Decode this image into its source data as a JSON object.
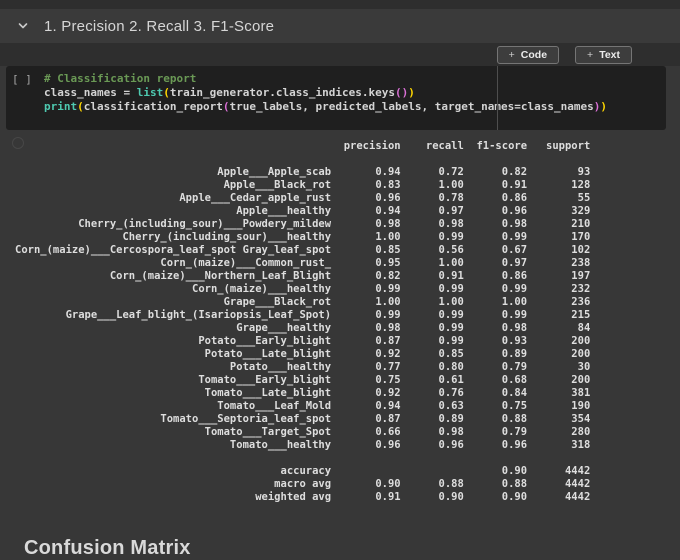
{
  "header": {
    "title": "1. Precision 2. Recall 3. F1-Score"
  },
  "toolbar": {
    "plus": "+",
    "code_label": "Code",
    "text_label": "Text"
  },
  "code": {
    "indicator": "[ ]",
    "token_colors": {
      "comment": "#6a9955",
      "plain": "#d4d4d4",
      "func": "#4ec9b0",
      "bracket1": "#ffd700",
      "bracket2": "#da70d6"
    },
    "lines": [
      [
        [
          "# Classification report",
          "comment"
        ]
      ],
      [
        [
          "class_names ",
          "plain"
        ],
        [
          "= ",
          "plain"
        ],
        [
          "list",
          "func"
        ],
        [
          "(",
          "bracket1"
        ],
        [
          "train_generator.class_indices.keys",
          "plain"
        ],
        [
          "(",
          "bracket2"
        ],
        [
          ")",
          "bracket2"
        ],
        [
          ")",
          "bracket1"
        ]
      ],
      [
        [
          "print",
          "func"
        ],
        [
          "(",
          "bracket1"
        ],
        [
          "classification_report",
          "plain"
        ],
        [
          "(",
          "bracket2"
        ],
        [
          "true_labels, predicted_labels, target_names",
          "plain"
        ],
        [
          "=",
          "plain"
        ],
        [
          "class_names",
          "plain"
        ],
        [
          ")",
          "bracket2"
        ],
        [
          ")",
          "bracket1"
        ]
      ]
    ]
  },
  "report": {
    "columns": [
      "precision",
      "recall",
      "f1-score",
      "support"
    ],
    "rows": [
      [
        "Apple___Apple_scab",
        "0.94",
        "0.72",
        "0.82",
        "93"
      ],
      [
        "Apple___Black_rot",
        "0.83",
        "1.00",
        "0.91",
        "128"
      ],
      [
        "Apple___Cedar_apple_rust",
        "0.96",
        "0.78",
        "0.86",
        "55"
      ],
      [
        "Apple___healthy",
        "0.94",
        "0.97",
        "0.96",
        "329"
      ],
      [
        "Cherry_(including_sour)___Powdery_mildew",
        "0.98",
        "0.98",
        "0.98",
        "210"
      ],
      [
        "Cherry_(including_sour)___healthy",
        "1.00",
        "0.99",
        "0.99",
        "170"
      ],
      [
        "Corn_(maize)___Cercospora_leaf_spot Gray_leaf_spot",
        "0.85",
        "0.56",
        "0.67",
        "102"
      ],
      [
        "Corn_(maize)___Common_rust_",
        "0.95",
        "1.00",
        "0.97",
        "238"
      ],
      [
        "Corn_(maize)___Northern_Leaf_Blight",
        "0.82",
        "0.91",
        "0.86",
        "197"
      ],
      [
        "Corn_(maize)___healthy",
        "0.99",
        "0.99",
        "0.99",
        "232"
      ],
      [
        "Grape___Black_rot",
        "1.00",
        "1.00",
        "1.00",
        "236"
      ],
      [
        "Grape___Leaf_blight_(Isariopsis_Leaf_Spot)",
        "0.99",
        "0.99",
        "0.99",
        "215"
      ],
      [
        "Grape___healthy",
        "0.98",
        "0.99",
        "0.98",
        "84"
      ],
      [
        "Potato___Early_blight",
        "0.87",
        "0.99",
        "0.93",
        "200"
      ],
      [
        "Potato___Late_blight",
        "0.92",
        "0.85",
        "0.89",
        "200"
      ],
      [
        "Potato___healthy",
        "0.77",
        "0.80",
        "0.79",
        "30"
      ],
      [
        "Tomato___Early_blight",
        "0.75",
        "0.61",
        "0.68",
        "200"
      ],
      [
        "Tomato___Late_blight",
        "0.92",
        "0.76",
        "0.84",
        "381"
      ],
      [
        "Tomato___Leaf_Mold",
        "0.94",
        "0.63",
        "0.75",
        "190"
      ],
      [
        "Tomato___Septoria_leaf_spot",
        "0.87",
        "0.89",
        "0.88",
        "354"
      ],
      [
        "Tomato___Target_Spot",
        "0.66",
        "0.98",
        "0.79",
        "280"
      ],
      [
        "Tomato___healthy",
        "0.96",
        "0.96",
        "0.96",
        "318"
      ]
    ],
    "summary": [
      [
        "accuracy",
        "",
        "",
        "0.90",
        "4442"
      ],
      [
        "macro avg",
        "0.90",
        "0.88",
        "0.88",
        "4442"
      ],
      [
        "weighted avg",
        "0.91",
        "0.90",
        "0.90",
        "4442"
      ]
    ]
  },
  "next_section": {
    "title": "Confusion Matrix"
  }
}
